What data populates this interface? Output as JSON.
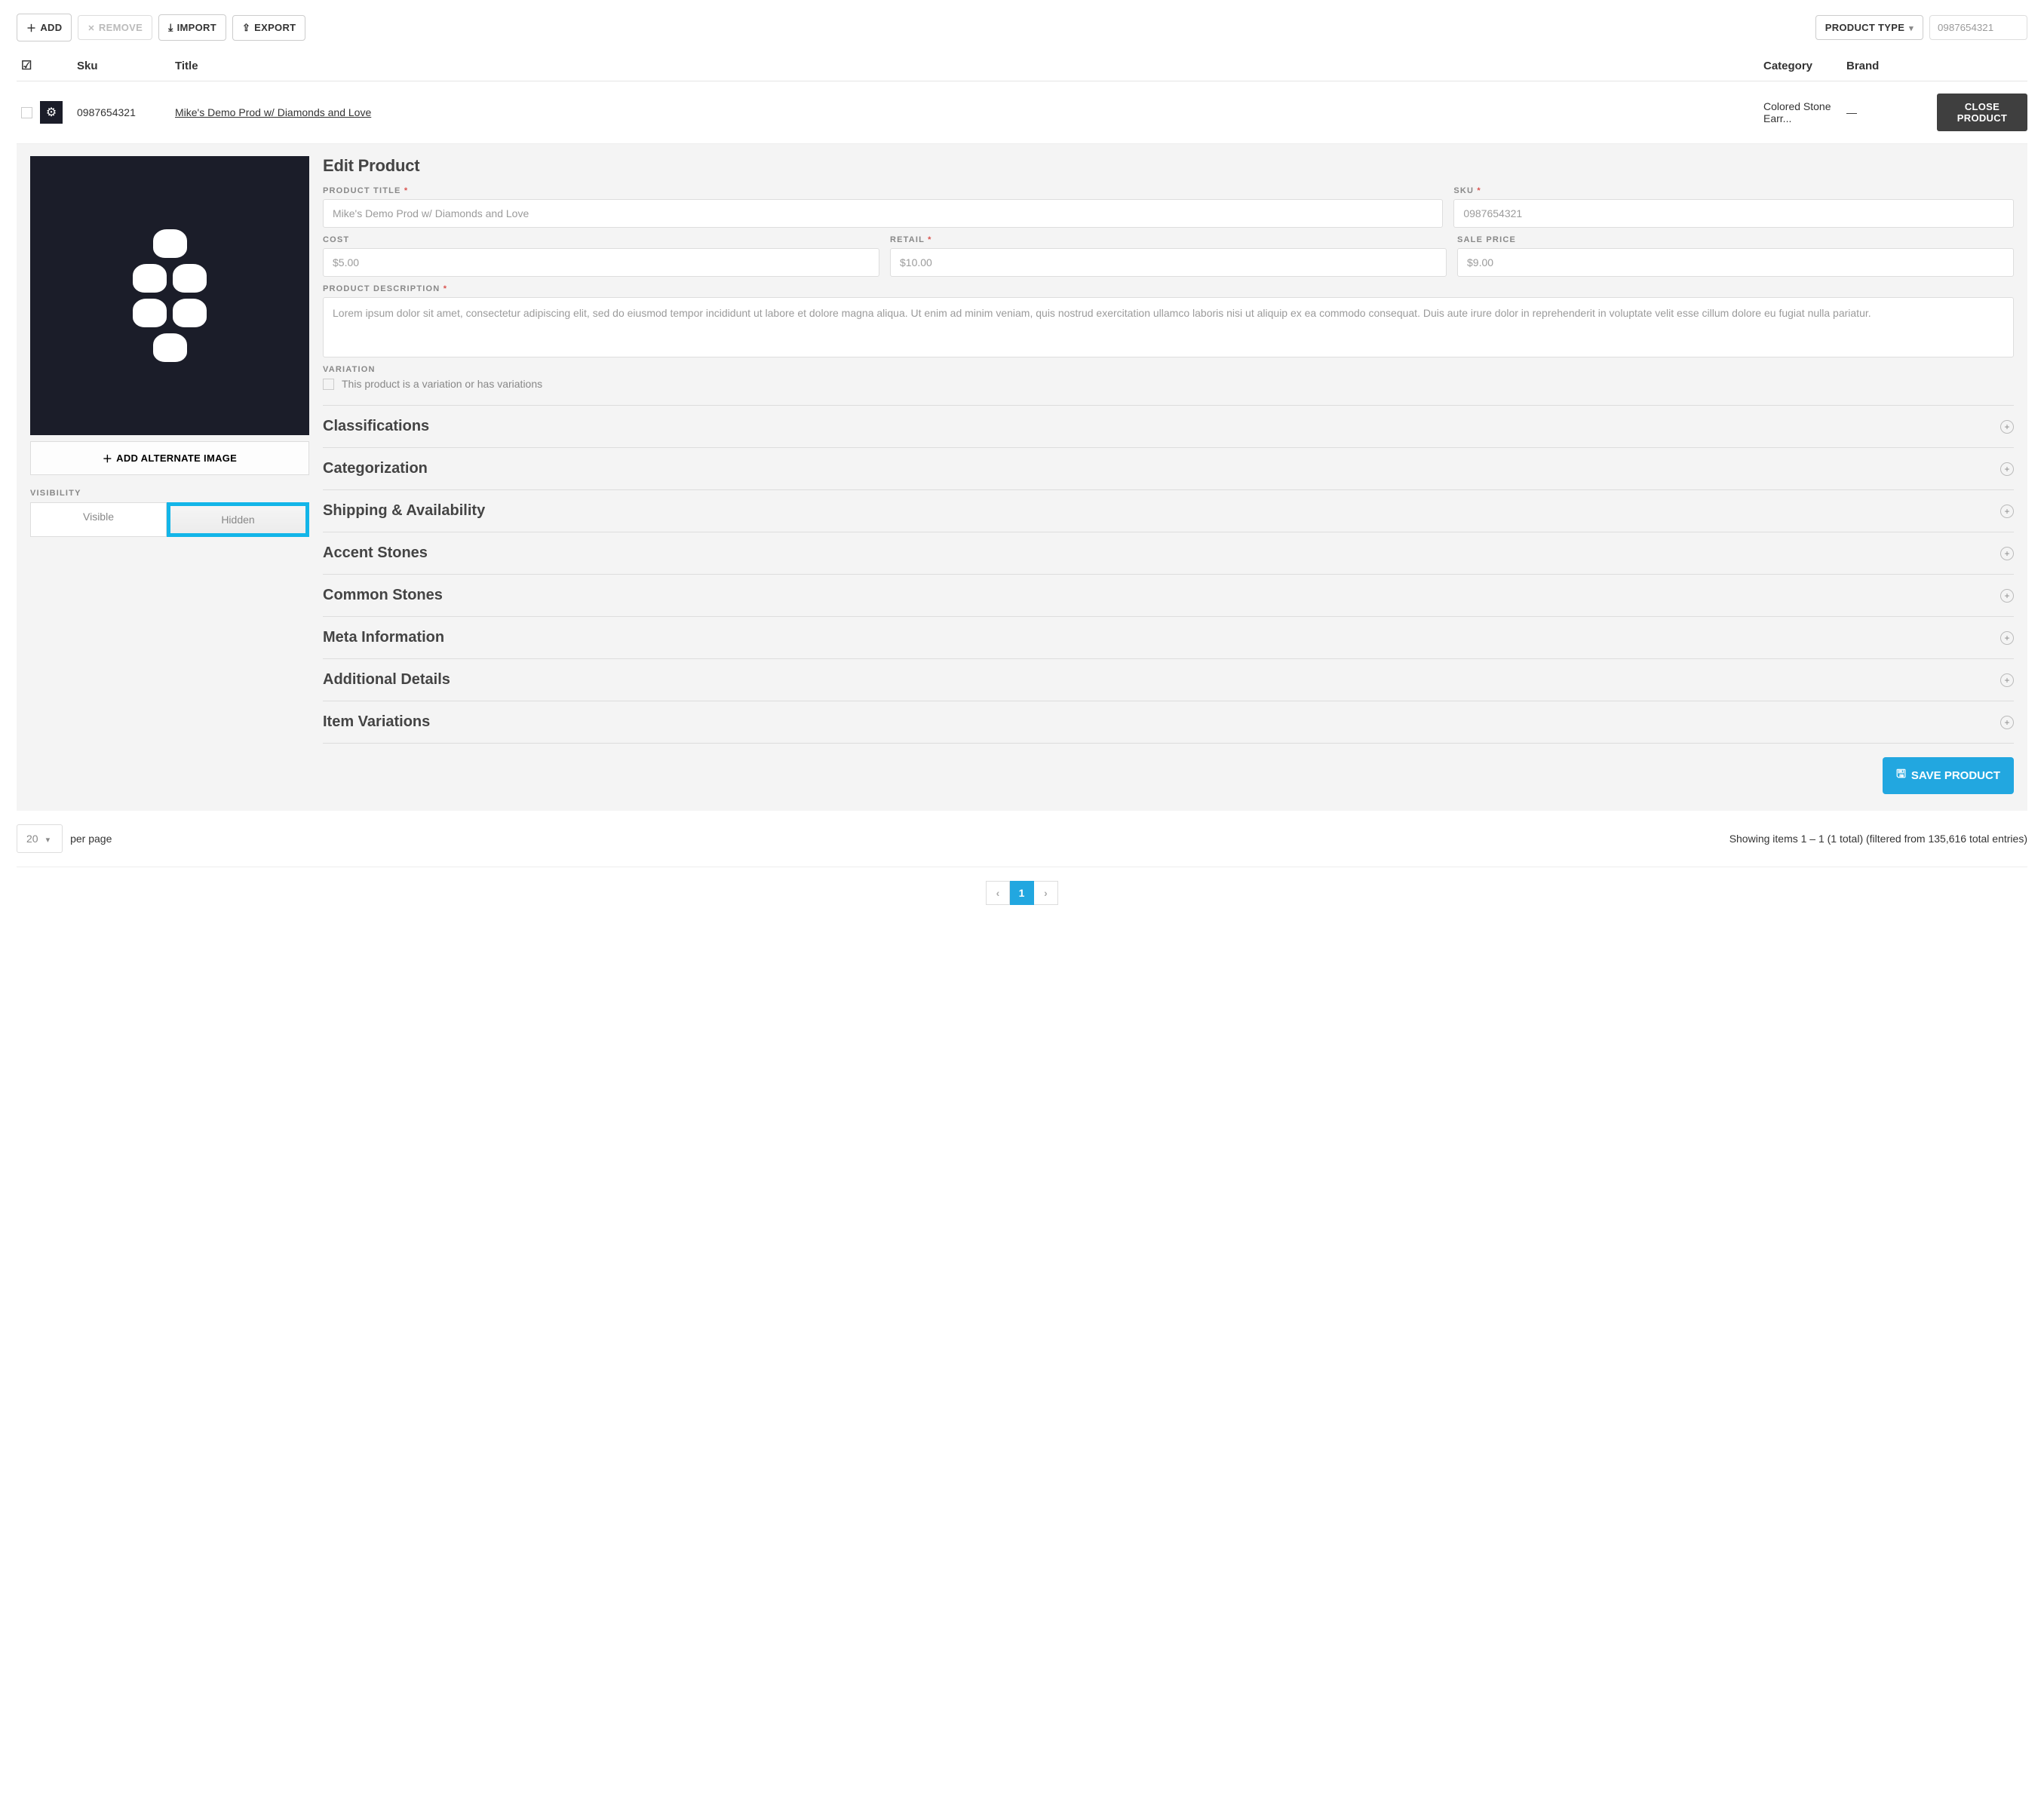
{
  "toolbar": {
    "add": "ADD",
    "remove": "REMOVE",
    "import": "IMPORT",
    "export": "EXPORT",
    "productType": "PRODUCT TYPE",
    "searchValue": "0987654321"
  },
  "tableHeaders": {
    "sku": "Sku",
    "title": "Title",
    "category": "Category",
    "brand": "Brand"
  },
  "row": {
    "sku": "0987654321",
    "title": "Mike's Demo Prod w/ Diamonds and Love",
    "category": "Colored Stone Earr...",
    "brand": "—",
    "closeBtn": "CLOSE PRODUCT"
  },
  "editor": {
    "heading": "Edit Product",
    "addAltImage": "ADD ALTERNATE IMAGE",
    "visibilityLabel": "VISIBILITY",
    "visible": "Visible",
    "hidden": "Hidden",
    "labels": {
      "productTitle": "PRODUCT TITLE",
      "sku": "SKU",
      "cost": "COST",
      "retail": "RETAIL",
      "salePrice": "SALE PRICE",
      "description": "PRODUCT DESCRIPTION",
      "variation": "VARIATION"
    },
    "values": {
      "productTitle": "Mike's Demo Prod w/ Diamonds and Love",
      "sku": "0987654321",
      "cost": "$5.00",
      "retail": "$10.00",
      "salePrice": "$9.00",
      "description": "Lorem ipsum dolor sit amet, consectetur adipiscing elit, sed do eiusmod tempor incididunt ut labore et dolore magna aliqua. Ut enim ad minim veniam, quis nostrud exercitation ullamco laboris nisi ut aliquip ex ea commodo consequat. Duis aute irure dolor in reprehenderit in voluptate velit esse cillum dolore eu fugiat nulla pariatur."
    },
    "variationText": "This product is a variation or has variations",
    "accordions": [
      "Classifications",
      "Categorization",
      "Shipping & Availability",
      "Accent Stones",
      "Common Stones",
      "Meta Information",
      "Additional Details",
      "Item Variations"
    ],
    "saveBtn": "SAVE PRODUCT"
  },
  "footer": {
    "perPageValue": "20",
    "perPageLabel": "per page",
    "resultsText": "Showing items 1 – 1 (1 total) (filtered from 135,616 total entries)",
    "currentPage": "1"
  }
}
